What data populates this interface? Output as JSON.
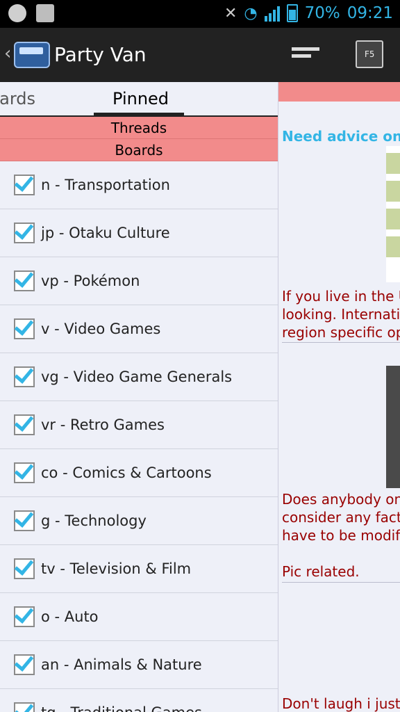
{
  "status": {
    "battery": "70%",
    "time": "09:21"
  },
  "app": {
    "title": "Party Van"
  },
  "tabs": [
    {
      "label": "Boards"
    },
    {
      "label": "Pinned"
    }
  ],
  "sections": {
    "threads": "Threads",
    "boards": "Boards"
  },
  "boards": [
    {
      "label": "n - Transportation",
      "checked": true
    },
    {
      "label": "jp - Otaku Culture",
      "checked": true
    },
    {
      "label": "vp - Pokémon",
      "checked": true
    },
    {
      "label": "v - Video Games",
      "checked": true
    },
    {
      "label": "vg - Video Game Generals",
      "checked": true
    },
    {
      "label": "vr - Retro Games",
      "checked": true
    },
    {
      "label": "co - Comics & Cartoons",
      "checked": true
    },
    {
      "label": "g - Technology",
      "checked": true
    },
    {
      "label": "tv - Television & Film",
      "checked": true
    },
    {
      "label": "o - Auto",
      "checked": true
    },
    {
      "label": "an - Animals & Nature",
      "checked": true
    },
    {
      "label": "tg - Traditional Games",
      "checked": true
    }
  ],
  "thread_preview": {
    "title": "Need advice on b",
    "post1": [
      "If you live in the U",
      "looking. Internatio",
      "region specific op"
    ],
    "post2": [
      "Does anybody on",
      "consider any fact",
      "have to be modifi",
      "",
      "Pic related."
    ],
    "post3": [
      "Don't laugh i just"
    ]
  },
  "icons": {
    "compose": "compose-icon",
    "refresh": "f5-refresh-icon"
  },
  "colors": {
    "accent": "#33b5e5",
    "header_bg": "#f28b8b",
    "post_text": "#990000"
  }
}
